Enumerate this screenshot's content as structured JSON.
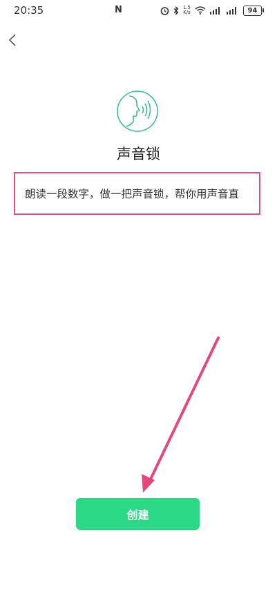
{
  "status_bar": {
    "time": "20:35",
    "nfc_icon": "N",
    "speed_top": "1.5",
    "speed_bottom": "K/s",
    "battery": "94"
  },
  "header": {
    "back_icon": "chevron-left-icon"
  },
  "main": {
    "logo_icon": "voice-face-icon",
    "title": "声音锁",
    "description": "朗读一段数字，做一把声音锁，帮你用声音直",
    "create_button": "创建"
  },
  "colors": {
    "accent": "#2bd886",
    "logo_stroke": "#3cc08a",
    "highlight_box": "#d9537a",
    "annotation_arrow": "#e2497a"
  }
}
